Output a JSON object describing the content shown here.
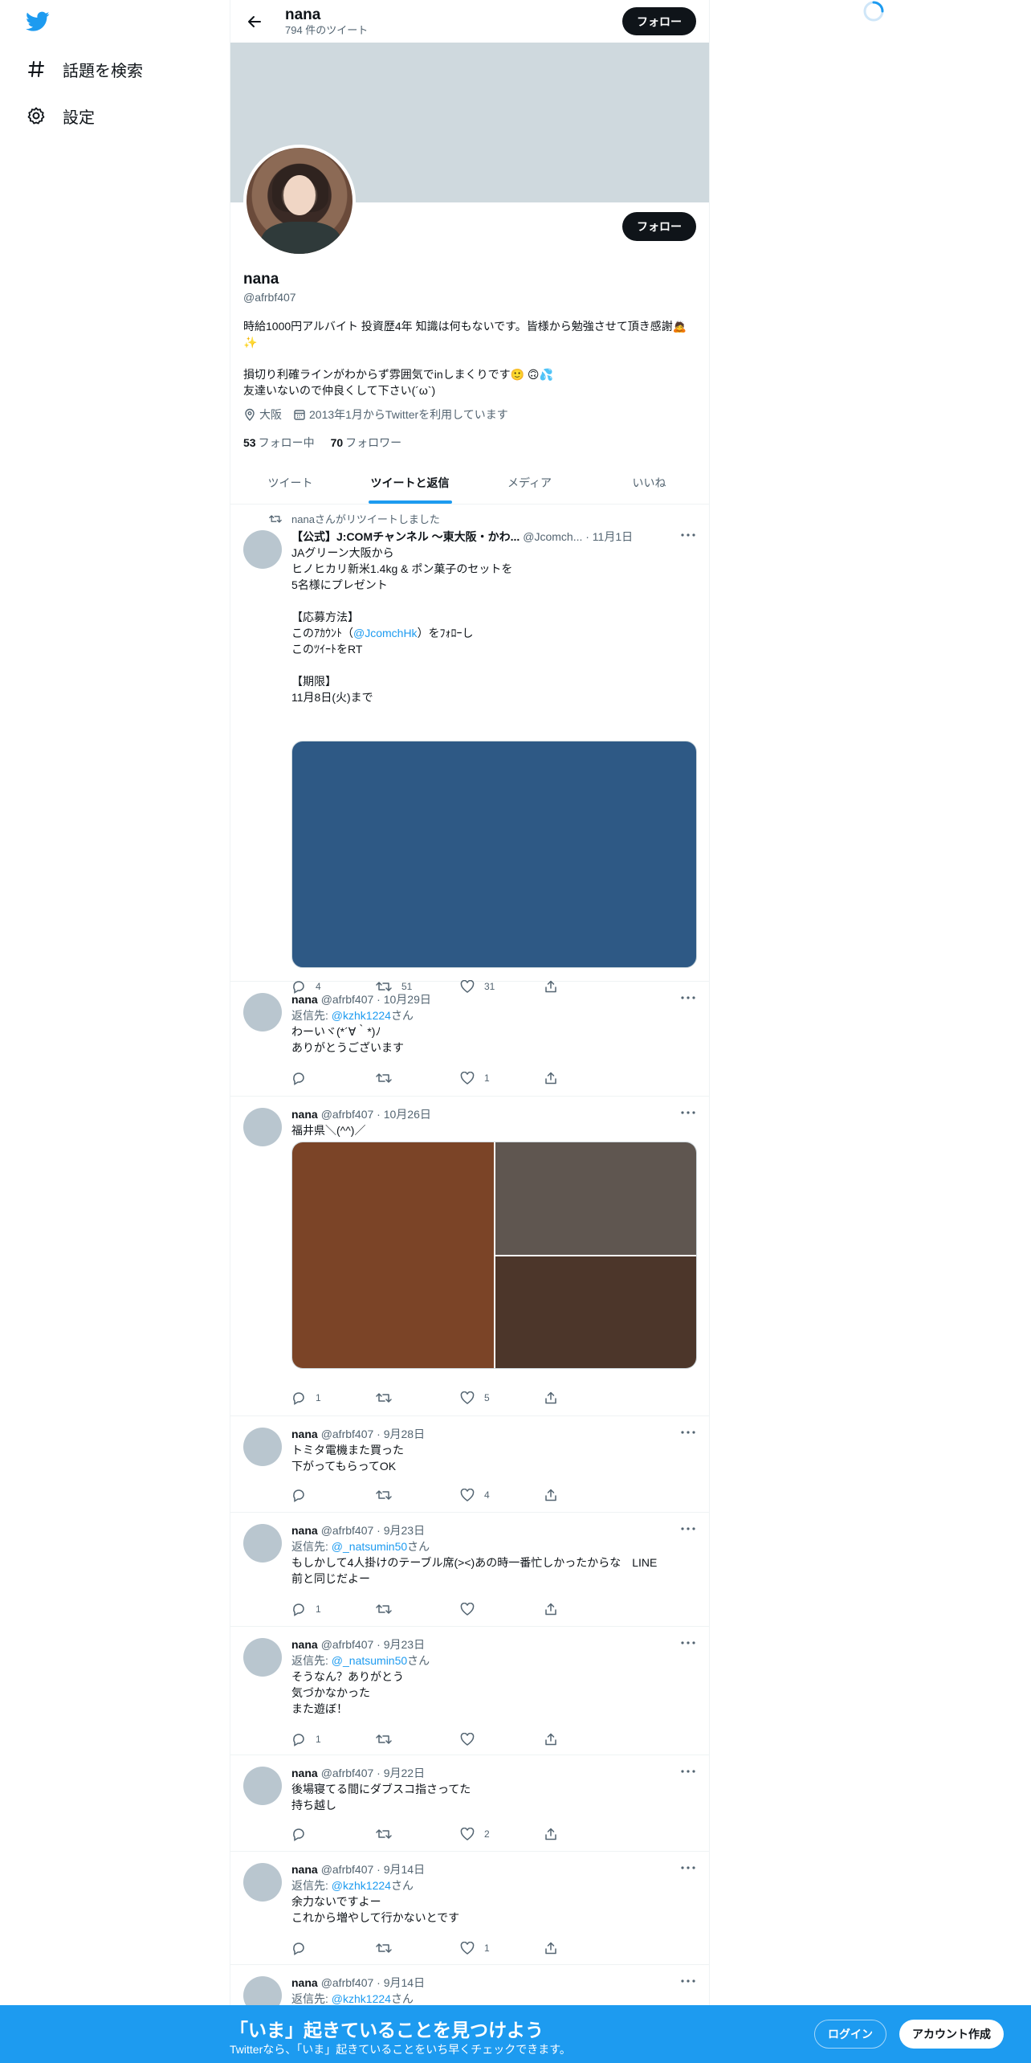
{
  "sidebar": {
    "items": [
      {
        "label": "話題を検索",
        "icon": "hashtag-icon"
      },
      {
        "label": "設定",
        "icon": "gear-icon"
      }
    ]
  },
  "header": {
    "name": "nana",
    "tweet_count": "794 件のツイート",
    "follow_label": "フォロー"
  },
  "profile": {
    "follow_label": "フォロー",
    "name": "nana",
    "handle": "@afrbf407",
    "bio": "時給1000円アルバイト 投資歴4年 知識は何もないです。皆様から勉強させて頂き感謝🙇✨\n\n損切り利確ラインがわからず雰囲気でinしまくりです🙂 🙃💦\n友達いないので仲良くして下さい(´ω`)",
    "location": "大阪",
    "joined": "2013年1月からTwitterを利用しています",
    "following_count": "53",
    "following_label": "フォロー中",
    "followers_count": "70",
    "followers_label": "フォロワー"
  },
  "tabs": [
    {
      "label": "ツイート",
      "active": false
    },
    {
      "label": "ツイートと返信",
      "active": true
    },
    {
      "label": "メディア",
      "active": false
    },
    {
      "label": "いいね",
      "active": false
    }
  ],
  "tweets": [
    {
      "retweet_context": "nanaさんがリツイートしました",
      "name": "【公式】J:COMチャンネル 〜東大阪・かわ...",
      "meta": "@Jcomch... · 11月1日",
      "text_1": "JAグリーン大阪から\nヒノヒカリ新米1.4kg & ポン菓子のセットを\n5名様にプレゼント\n\n【応募方法】\nこのｱｶｳﾝﾄ（",
      "mention": "@JcomchHk",
      "text_2": "）をﾌｫﾛｰし\nこのﾂｲｰﾄをRT\n\n【期限】\n11月8日(火)まで",
      "reply_count": "4",
      "retweet_count": "51",
      "like_count": "31"
    },
    {
      "name": "nana",
      "meta": "@afrbf407 · 10月29日",
      "reply_prefix": "返信先: ",
      "reply_user": "@kzhk1224",
      "reply_suffix": "さん",
      "text": "わーいヾ(*´∀｀*)ﾉ\nありがとうございます",
      "reply_count": "",
      "retweet_count": "",
      "like_count": "1"
    },
    {
      "name": "nana",
      "meta": "@afrbf407 · 10月26日",
      "text": "福井県＼(^^)／",
      "reply_count": "1",
      "retweet_count": "",
      "like_count": "5"
    },
    {
      "name": "nana",
      "meta": "@afrbf407 · 9月28日",
      "text": "トミタ電機また買った\n下がってもらってOK",
      "reply_count": "",
      "retweet_count": "",
      "like_count": "4"
    },
    {
      "name": "nana",
      "meta": "@afrbf407 · 9月23日",
      "reply_prefix": "返信先: ",
      "reply_user": "@_natsumin50",
      "reply_suffix": "さん",
      "text": "もしかして4人掛けのテーブル席(>&lt;)あの時一番忙しかったからな　LINE\n前と同じだよー",
      "reply_count": "1",
      "retweet_count": "",
      "like_count": ""
    },
    {
      "name": "nana",
      "meta": "@afrbf407 · 9月23日",
      "reply_prefix": "返信先: ",
      "reply_user": "@_natsumin50",
      "reply_suffix": "さん",
      "text": "そうなん？ありがとう\n気づかなかった\nまた遊ぼ！",
      "reply_count": "1",
      "retweet_count": "",
      "like_count": ""
    },
    {
      "name": "nana",
      "meta": "@afrbf407 · 9月22日",
      "text": "後場寝てる間にダブスコ指さってた\n持ち越し",
      "reply_count": "",
      "retweet_count": "",
      "like_count": "2"
    },
    {
      "name": "nana",
      "meta": "@afrbf407 · 9月14日",
      "reply_prefix": "返信先: ",
      "reply_user": "@kzhk1224",
      "reply_suffix": "さん",
      "text": "余力ないですよー\nこれから増やして行かないとです",
      "reply_count": "",
      "retweet_count": "",
      "like_count": "1"
    },
    {
      "name": "nana",
      "meta": "@afrbf407 · 9月14日",
      "reply_prefix": "返信先: ",
      "reply_user": "@kzhk1224",
      "reply_suffix": "さん"
    }
  ],
  "bottom_bar": {
    "title": "「いま」起きていることを見つけよう",
    "subtitle": "Twitterなら、「いま」起きていることをいち早くチェックできます。",
    "login_label": "ログイン",
    "signup_label": "アカウント作成"
  },
  "colors": {
    "accent": "#1d9bf0",
    "text": "#0f1419",
    "muted": "#536471",
    "banner": "#cfd9de"
  }
}
